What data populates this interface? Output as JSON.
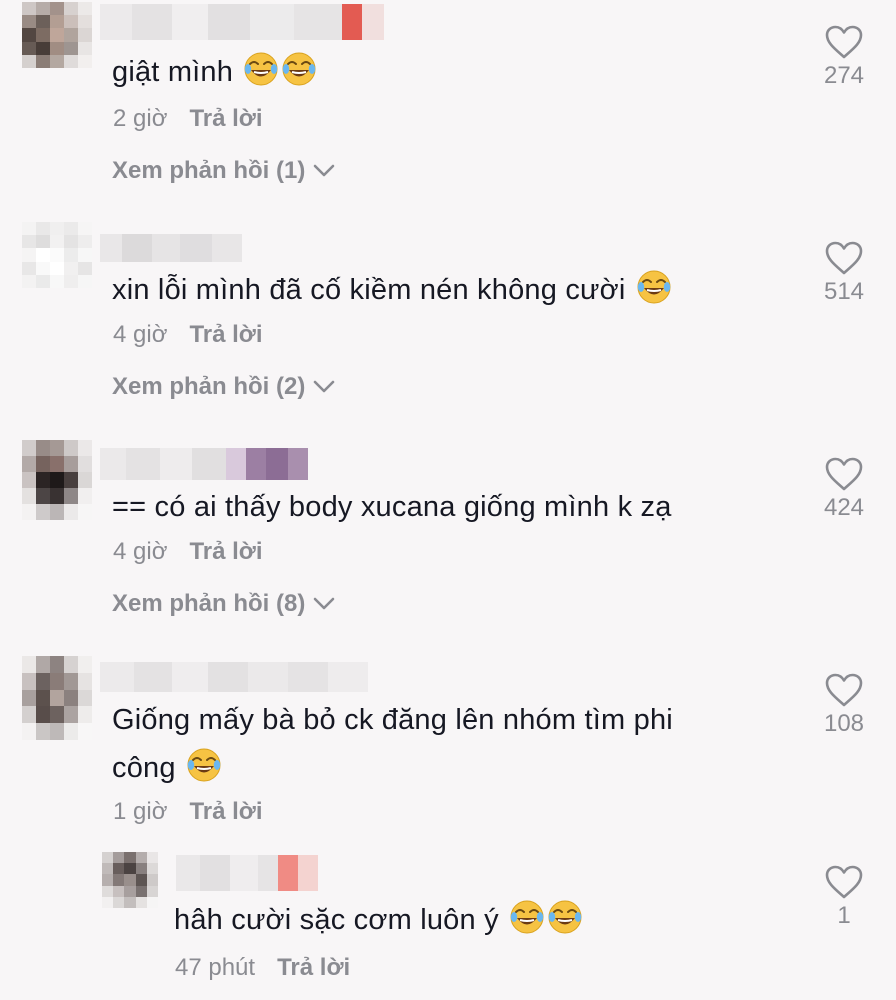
{
  "comments": [
    {
      "text": "giật mình",
      "time": "2 giờ",
      "reply_label": "Trả lời",
      "view_replies": "Xem phản hồi (1)",
      "likes": "274",
      "emoji_count": 2
    },
    {
      "text": "xin lỗi mình đã cố kiềm nén không cười",
      "time": "4 giờ",
      "reply_label": "Trả lời",
      "view_replies": "Xem phản hồi (2)",
      "likes": "514",
      "emoji_count": 1
    },
    {
      "text": "== có ai thấy body xucana giống mình k zạ",
      "time": "4 giờ",
      "reply_label": "Trả lời",
      "view_replies": "Xem phản hồi (8)",
      "likes": "424",
      "emoji_count": 0
    },
    {
      "text_line1": "Giống mấy bà bỏ ck đăng lên nhóm tìm phi",
      "text_line2": "công",
      "time": "1 giờ",
      "reply_label": "Trả lời",
      "likes": "108",
      "emoji_count": 1
    }
  ],
  "reply": {
    "text": "hâh cười sặc cơm luôn ý",
    "time": "47 phút",
    "reply_label": "Trả lời",
    "likes": "1",
    "emoji_count": 2
  },
  "icons": {
    "emoji": "face-with-tears-of-joy-icon",
    "like": "heart-outline-icon",
    "expand": "chevron-down-icon"
  },
  "colors": {
    "background": "#f8f6f7",
    "text": "#161823",
    "secondary": "#8a8b91"
  }
}
